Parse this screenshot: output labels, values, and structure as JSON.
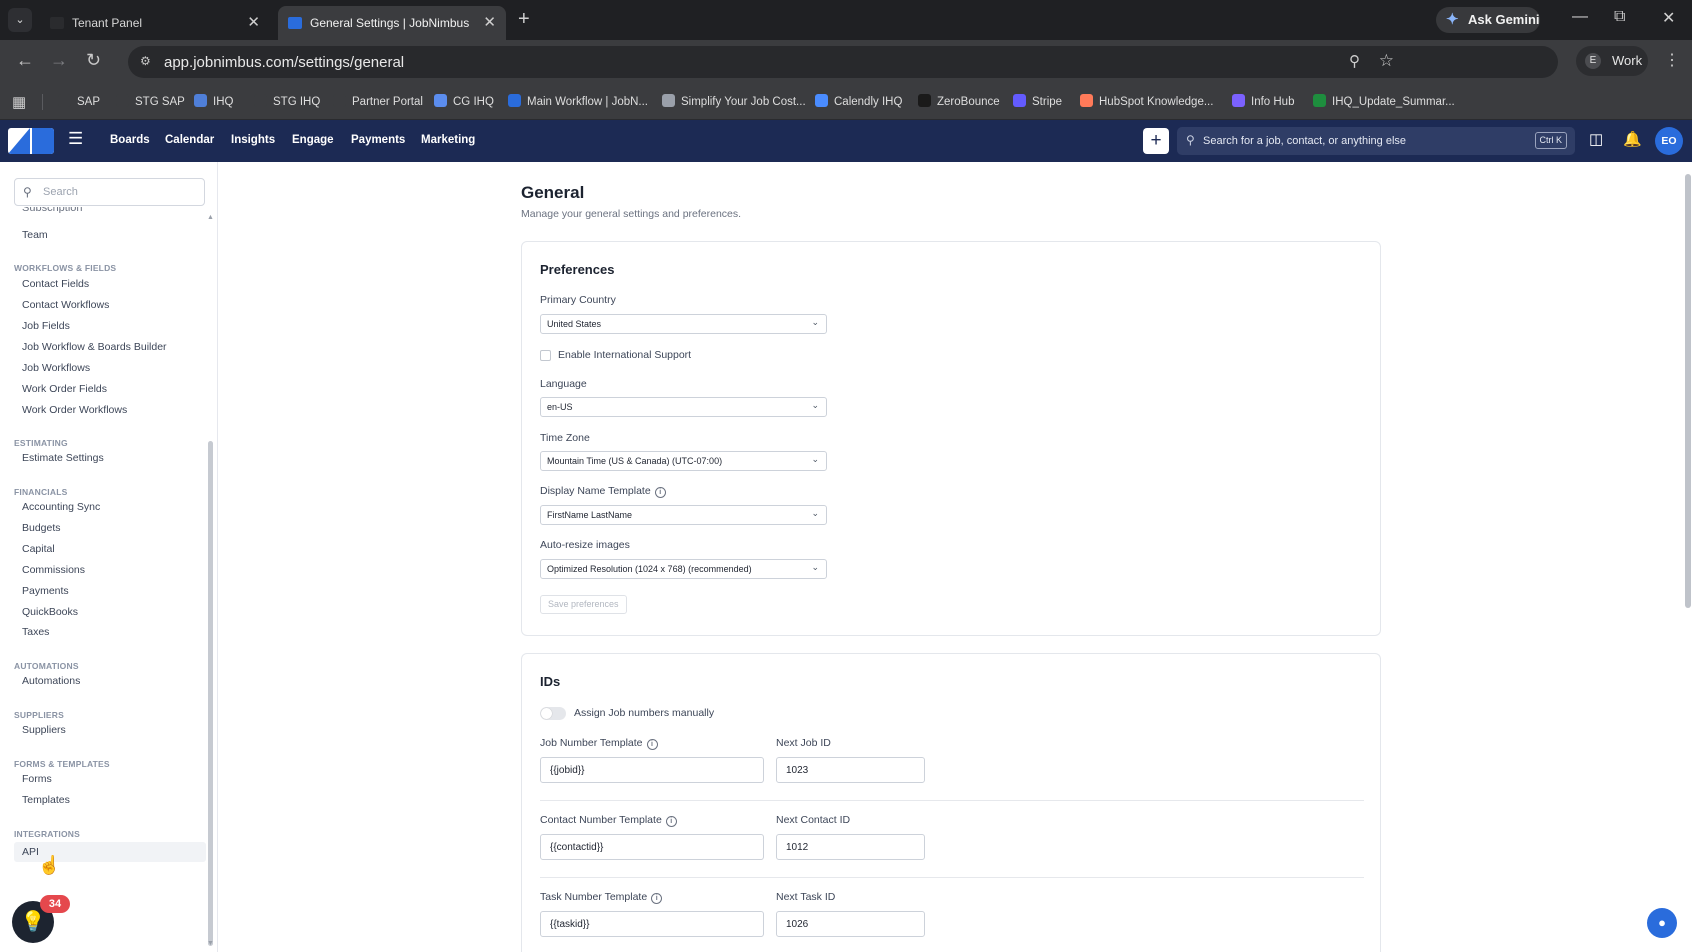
{
  "browser": {
    "tabs": [
      {
        "title": "Tenant Panel",
        "active": false
      },
      {
        "title": "General Settings | JobNimbus",
        "active": true
      }
    ],
    "new_tab_icon": "plus-icon",
    "gemini_label": "Ask Gemini",
    "url": "app.jobnimbus.com/settings/general",
    "profile_initial": "E",
    "profile_label": "Work",
    "bookmarks": [
      {
        "label": "SAP",
        "color": "#3b3c3f"
      },
      {
        "label": "STG SAP",
        "color": "#3b3c3f"
      },
      {
        "label": "IHQ",
        "color": "#4f7fd9"
      },
      {
        "label": "STG IHQ",
        "color": "#3b3c3f"
      },
      {
        "label": "Partner Portal",
        "color": "#3b3c3f"
      },
      {
        "label": "CG IHQ",
        "color": "#5b8def"
      },
      {
        "label": "Main Workflow | JobN...",
        "color": "#2a6cdc"
      },
      {
        "label": "Simplify Your Job Cost...",
        "color": "#9aa0aa"
      },
      {
        "label": "Calendly IHQ",
        "color": "#4a8cff"
      },
      {
        "label": "ZeroBounce",
        "color": "#1a1a1a"
      },
      {
        "label": "Stripe",
        "color": "#635bff"
      },
      {
        "label": "HubSpot Knowledge...",
        "color": "#ff7a59"
      },
      {
        "label": "Info Hub",
        "color": "#7b61ff"
      },
      {
        "label": "IHQ_Update_Summar...",
        "color": "#1e8e3e"
      }
    ]
  },
  "app": {
    "nav": [
      "Boards",
      "Calendar",
      "Insights",
      "Engage",
      "Payments",
      "Marketing"
    ],
    "search_placeholder": "Search for a job, contact, or anything else",
    "search_shortcut": "Ctrl K",
    "avatar_initials": "EO",
    "brand_color": "#1c2a54",
    "accent_color": "#2a6cdc"
  },
  "sidebar": {
    "search_placeholder": "Search",
    "cut_item": "Subscription",
    "top_item": "Team",
    "sections": [
      {
        "title": "WORKFLOWS & FIELDS",
        "items": [
          "Contact Fields",
          "Contact Workflows",
          "Job Fields",
          "Job Workflow & Boards Builder",
          "Job Workflows",
          "Work Order Fields",
          "Work Order Workflows"
        ]
      },
      {
        "title": "ESTIMATING",
        "items": [
          "Estimate Settings"
        ]
      },
      {
        "title": "FINANCIALS",
        "items": [
          "Accounting Sync",
          "Budgets",
          "Capital",
          "Commissions",
          "Payments",
          "QuickBooks",
          "Taxes"
        ]
      },
      {
        "title": "AUTOMATIONS",
        "items": [
          "Automations"
        ]
      },
      {
        "title": "SUPPLIERS",
        "items": [
          "Suppliers"
        ]
      },
      {
        "title": "FORMS & TEMPLATES",
        "items": [
          "Forms",
          "Templates"
        ]
      },
      {
        "title": "INTEGRATIONS",
        "items": [
          "API"
        ]
      }
    ],
    "help_badge": "34"
  },
  "page": {
    "title": "General",
    "subtitle": "Manage your general settings and preferences.",
    "preferences": {
      "title": "Preferences",
      "primary_country_label": "Primary Country",
      "primary_country_value": "United States",
      "intl_support_label": "Enable International Support",
      "intl_support_checked": false,
      "language_label": "Language",
      "language_value": "en-US",
      "timezone_label": "Time Zone",
      "timezone_value": "Mountain Time (US & Canada) (UTC-07:00)",
      "display_name_label": "Display Name Template",
      "display_name_value": "FirstName LastName",
      "autoresize_label": "Auto-resize images",
      "autoresize_value": "Optimized Resolution (1024 x 768) (recommended)",
      "save_label": "Save preferences"
    },
    "ids": {
      "title": "IDs",
      "assign_manual_label": "Assign Job numbers manually",
      "assign_manual_on": false,
      "job_template_label": "Job Number Template",
      "job_template_value": "{{jobid}}",
      "next_job_label": "Next Job ID",
      "next_job_value": "1023",
      "contact_template_label": "Contact Number Template",
      "contact_template_value": "{{contactid}}",
      "next_contact_label": "Next Contact ID",
      "next_contact_value": "1012",
      "task_template_label": "Task Number Template",
      "task_template_value": "{{taskid}}",
      "next_task_label": "Next Task ID",
      "next_task_value": "1026"
    }
  }
}
